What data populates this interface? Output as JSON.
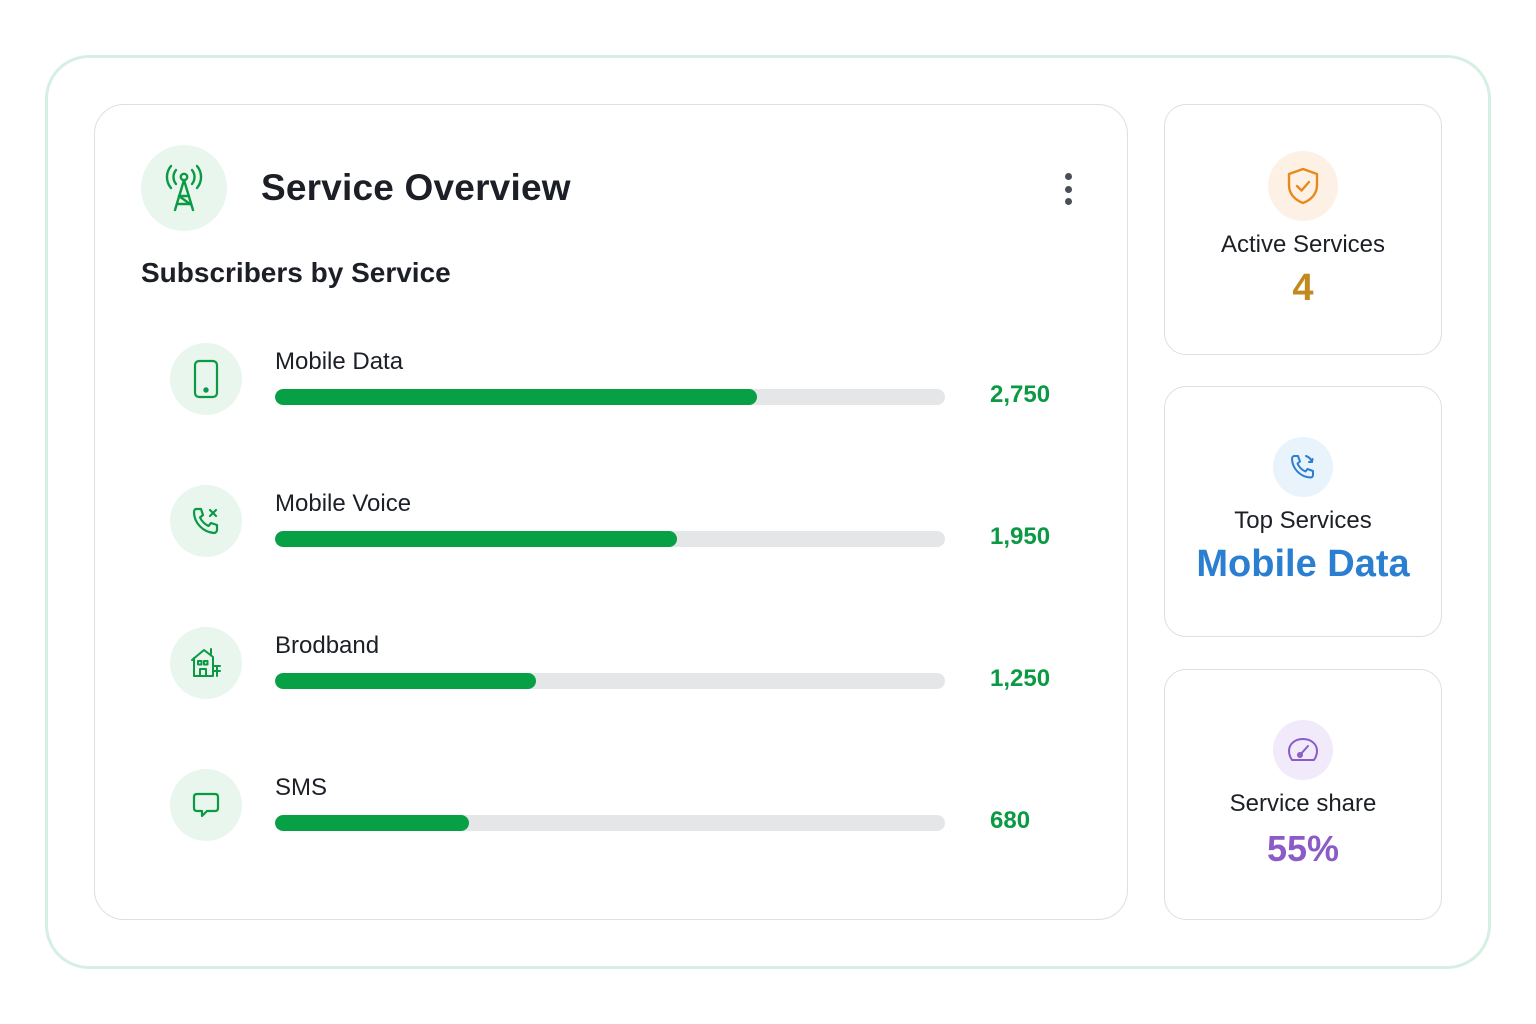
{
  "overview": {
    "title": "Service Overview",
    "header_icon": "cell-tower-icon",
    "menu_icon": "kebab-menu-icon",
    "section_title": "Subscribers by Service",
    "accent_color": "#08a045",
    "services": [
      {
        "label": "Mobile Data",
        "value": "2,750",
        "icon": "smartphone-icon",
        "fill_percent": 72
      },
      {
        "label": "Mobile Voice",
        "value": "1,950",
        "icon": "phone-missed-icon",
        "fill_percent": 60
      },
      {
        "label": "Brodband",
        "value": "1,250",
        "icon": "building-icon",
        "fill_percent": 39
      },
      {
        "label": "SMS",
        "value": "680",
        "icon": "message-icon",
        "fill_percent": 29
      }
    ]
  },
  "stats": {
    "active": {
      "label": "Active Services",
      "value": "4",
      "icon": "shield-check-icon",
      "color": "#c28a1e"
    },
    "top": {
      "label": "Top Services",
      "value": "Mobile Data",
      "icon": "phone-forward-icon",
      "color": "#2b7fd0"
    },
    "share": {
      "label": "Service share",
      "value": "55%",
      "icon": "gauge-icon",
      "color": "#8b5bc8"
    }
  }
}
